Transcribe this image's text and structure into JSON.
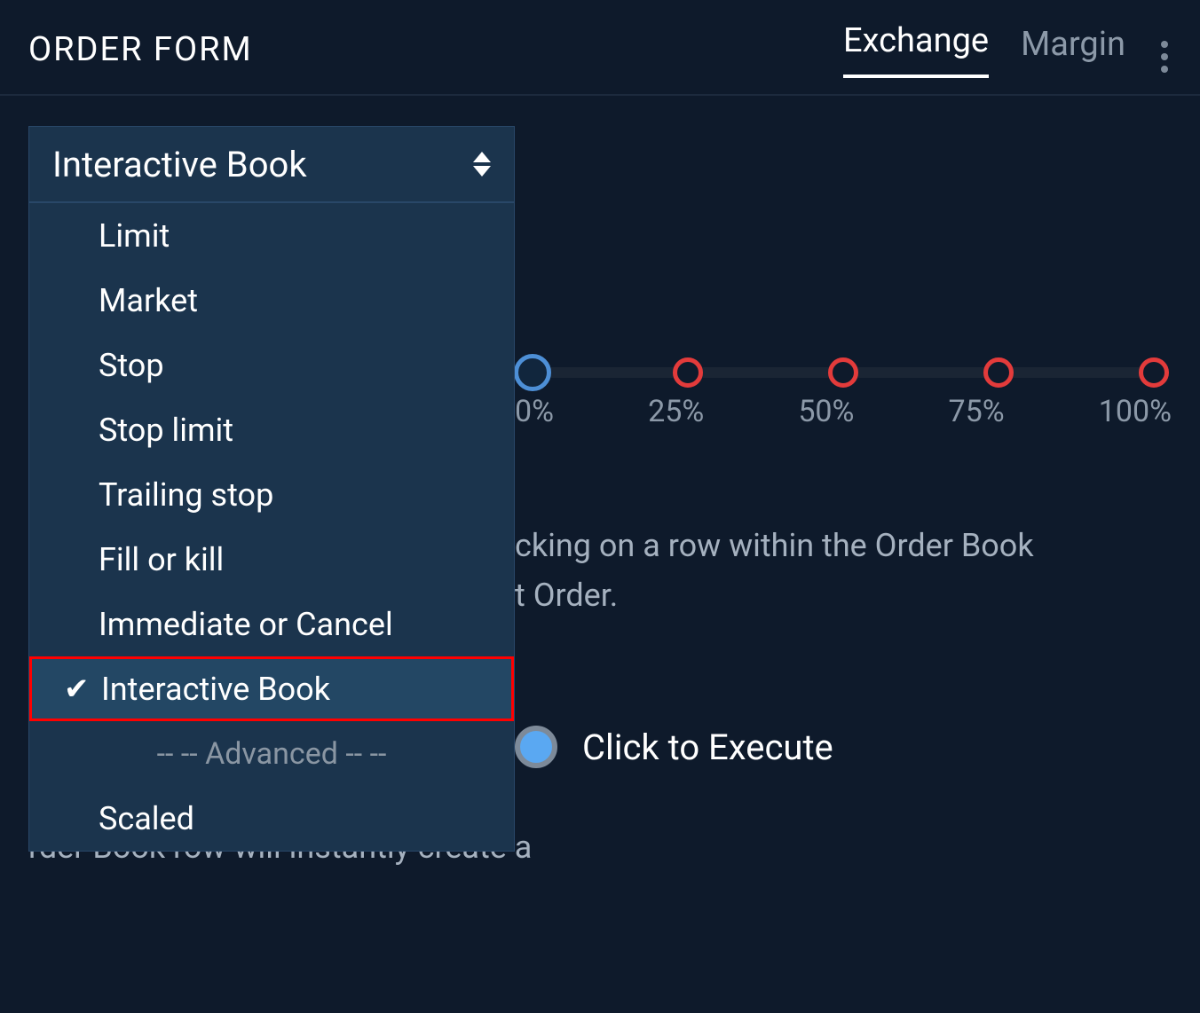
{
  "header": {
    "title": "ORDER FORM",
    "tabs": [
      {
        "label": "Exchange",
        "active": true
      },
      {
        "label": "Margin",
        "active": false
      }
    ]
  },
  "order_type_select": {
    "current": "Interactive Book",
    "options": [
      "Limit",
      "Market",
      "Stop",
      "Stop limit",
      "Trailing stop",
      "Fill or kill",
      "Immediate or Cancel",
      "Interactive Book"
    ],
    "separator_label": "-- -- Advanced -- --",
    "advanced_options": [
      "Scaled"
    ],
    "selected_index": 7
  },
  "slider": {
    "stops": [
      "0%",
      "25%",
      "50%",
      "75%",
      "100%"
    ],
    "first_visible_fragment": "0%"
  },
  "description_fragments": {
    "line1_right": "cking on a row within the Order Book",
    "line2_right": "t Order."
  },
  "mode": {
    "selected_label": "Click to Execute",
    "desc_fragment": "rder Book row will instantly create a"
  }
}
